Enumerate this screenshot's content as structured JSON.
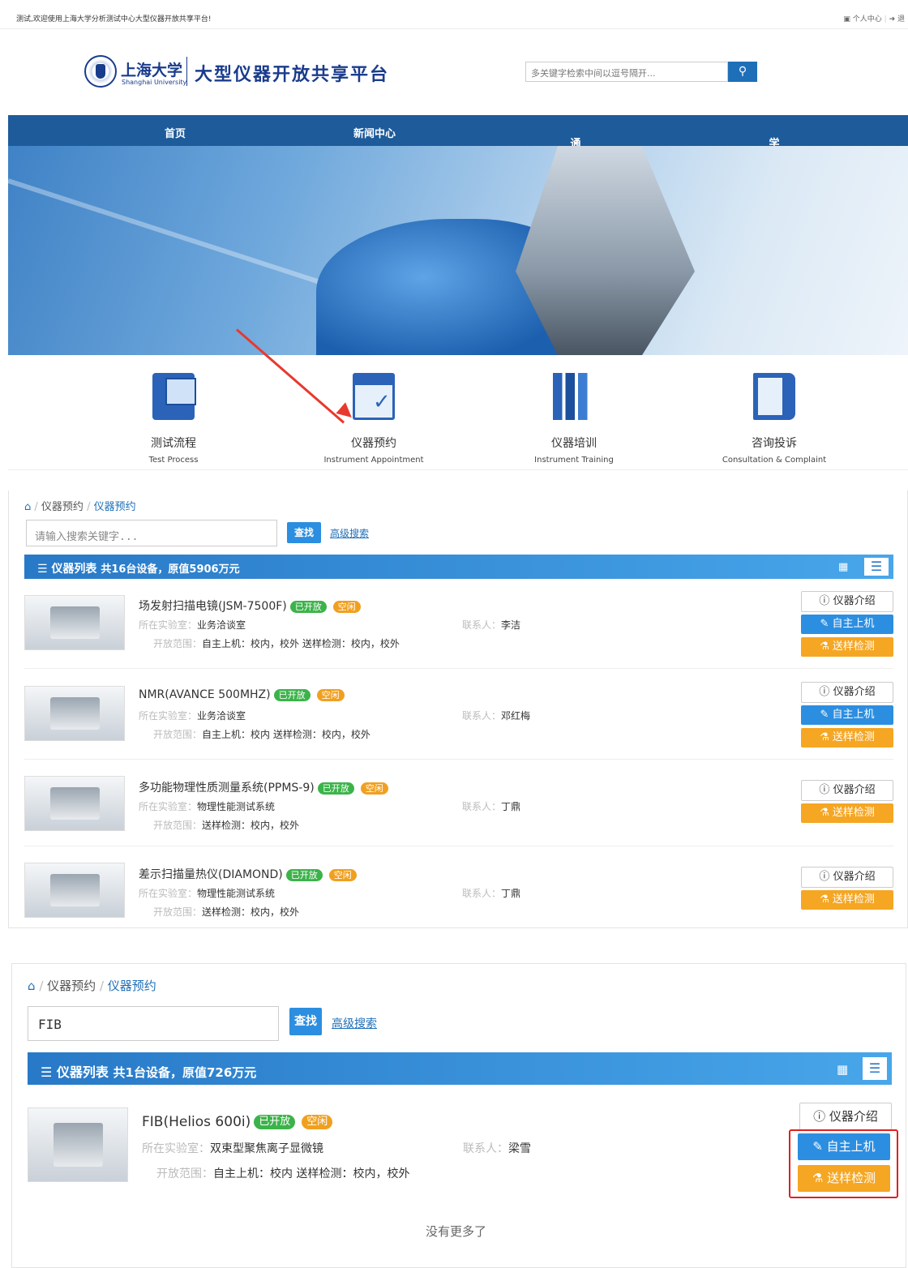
{
  "topbar": {
    "welcome": "测试,欢迎使用上海大学分析测试中心大型仪器开放共享平台!",
    "personal": "个人中心",
    "logout": "退"
  },
  "header": {
    "univ_cn": "上海大学",
    "univ_en": "Shanghai University",
    "platform_title": "大型仪器开放共享平台",
    "search_placeholder": "多关键字检索中间以逗号隔开..."
  },
  "nav": [
    "首页",
    "新闻中心",
    "通知公告",
    "学院导航"
  ],
  "quick_links": [
    {
      "cn": "测试流程",
      "en": "Test Process",
      "icon": "computer-icon"
    },
    {
      "cn": "仪器预约",
      "en": "Instrument Appointment",
      "icon": "calendar-icon"
    },
    {
      "cn": "仪器培训",
      "en": "Instrument Training",
      "icon": "books-icon"
    },
    {
      "cn": "咨询投诉",
      "en": "Consultation & Complaint",
      "icon": "book-icon"
    }
  ],
  "panel1": {
    "breadcrumb": [
      "仪器预约",
      "仪器预约"
    ],
    "search_placeholder": "请输入搜索关键字...",
    "search_btn": "查找",
    "advanced": "高级搜索",
    "list_title": "仪器列表",
    "list_summary": "共16台设备，原值5906万元",
    "items": [
      {
        "name": "场发射扫描电镜(JSM-7500F)",
        "open": "已开放",
        "idle": "空闲",
        "lab_label": "所在实验室：",
        "lab": "业务洽谈室",
        "contact_label": "联系人：",
        "contact": "李洁",
        "range_label": "开放范围：",
        "range": "自主上机：校内，校外   送样检测：校内，校外",
        "intro": "仪器介绍",
        "self": "自主上机",
        "send": "送样检测"
      },
      {
        "name": "NMR(AVANCE 500MHZ)",
        "open": "已开放",
        "idle": "空闲",
        "lab_label": "所在实验室：",
        "lab": "业务洽谈室",
        "contact_label": "联系人：",
        "contact": "邓红梅",
        "range_label": "开放范围：",
        "range": "自主上机：校内   送样检测：校内，校外",
        "intro": "仪器介绍",
        "self": "自主上机",
        "send": "送样检测"
      },
      {
        "name": "多功能物理性质测量系统(PPMS-9)",
        "open": "已开放",
        "idle": "空闲",
        "lab_label": "所在实验室：",
        "lab": "物理性能测试系统",
        "contact_label": "联系人：",
        "contact": "丁鼎",
        "range_label": "开放范围：",
        "range": "送样检测：校内，校外",
        "intro": "仪器介绍",
        "send": "送样检测"
      },
      {
        "name": "差示扫描量热仪(DIAMOND)",
        "open": "已开放",
        "idle": "空闲",
        "lab_label": "所在实验室：",
        "lab": "物理性能测试系统",
        "contact_label": "联系人：",
        "contact": "丁鼎",
        "range_label": "开放范围：",
        "range": "送样检测：校内，校外",
        "intro": "仪器介绍",
        "send": "送样检测"
      }
    ]
  },
  "panel2": {
    "breadcrumb": [
      "仪器预约",
      "仪器预约"
    ],
    "search_value": "FIB",
    "search_btn": "查找",
    "advanced": "高级搜索",
    "list_title": "仪器列表",
    "list_summary": "共1台设备，原值726万元",
    "item": {
      "name": "FIB(Helios 600i)",
      "open": "已开放",
      "idle": "空闲",
      "lab_label": "所在实验室：",
      "lab": "双束型聚焦离子显微镜",
      "contact_label": "联系人：",
      "contact": "梁雪",
      "range_label": "开放范围：",
      "range": "自主上机：校内   送样检测：校内，校外",
      "intro": "仪器介绍",
      "self": "自主上机",
      "send": "送样检测"
    },
    "no_more": "没有更多了"
  },
  "colors": {
    "primary": "#2c8ee0",
    "warning": "#f5a623",
    "success": "#3cb34a",
    "nav": "#1d5b9a",
    "annotation": "#e02020"
  }
}
